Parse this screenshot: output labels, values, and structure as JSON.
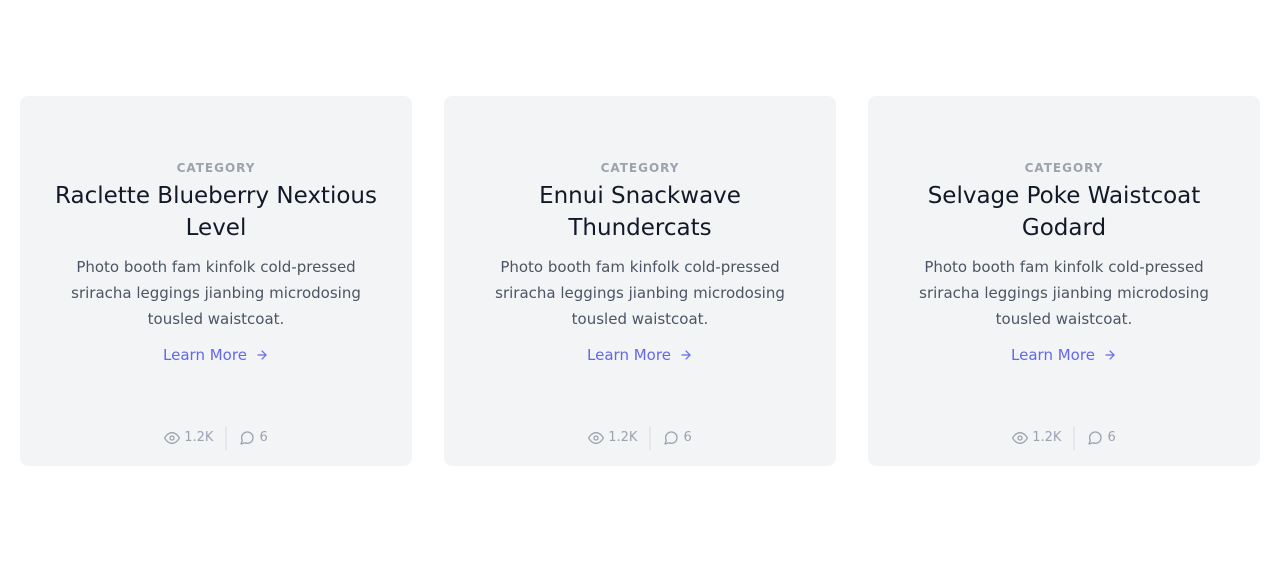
{
  "cards": [
    {
      "category": "CATEGORY",
      "title": "Raclette Blueberry Nextious Level",
      "description": "Photo booth fam kinfolk cold-pressed sriracha leggings jianbing microdosing tousled waistcoat.",
      "link_label": "Learn More",
      "views": "1.2K",
      "comments": "6"
    },
    {
      "category": "CATEGORY",
      "title": "Ennui Snackwave Thundercats",
      "description": "Photo booth fam kinfolk cold-pressed sriracha leggings jianbing microdosing tousled waistcoat.",
      "link_label": "Learn More",
      "views": "1.2K",
      "comments": "6"
    },
    {
      "category": "CATEGORY",
      "title": "Selvage Poke Waistcoat Godard",
      "description": "Photo booth fam kinfolk cold-pressed sriracha leggings jianbing microdosing tousled waistcoat.",
      "link_label": "Learn More",
      "views": "1.2K",
      "comments": "6"
    }
  ],
  "icons": {
    "views": "eye-icon",
    "comments": "chat-bubble-icon",
    "link": "arrow-right-icon"
  },
  "colors": {
    "card_background": "#f3f4f6",
    "accent": "#6366f1",
    "title": "#111827",
    "muted": "#9ca3af"
  }
}
